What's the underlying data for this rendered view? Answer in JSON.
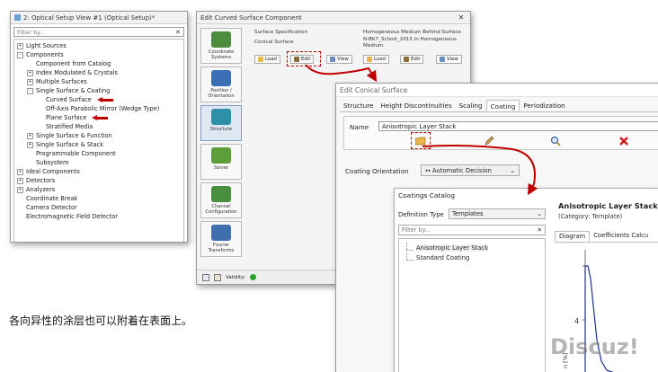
{
  "tree_window": {
    "title": "2: Optical Setup View #1 (Optical Setup)*",
    "filter_placeholder": "Filter by...",
    "items": [
      {
        "label": "Light Sources",
        "expander": "+",
        "level": 0
      },
      {
        "label": "Components",
        "expander": "-",
        "level": 0
      },
      {
        "label": "Component from Catalog",
        "expander": "",
        "level": 1
      },
      {
        "label": "Index Modulated & Crystals",
        "expander": "+",
        "level": 1
      },
      {
        "label": "Multiple Surfaces",
        "expander": "+",
        "level": 1
      },
      {
        "label": "Single Surface & Coating",
        "expander": "-",
        "level": 1
      },
      {
        "label": "Curved Surface",
        "expander": "",
        "level": 2,
        "marked": true
      },
      {
        "label": "Off-Axis Parabolic Mirror (Wedge Type)",
        "expander": "",
        "level": 2
      },
      {
        "label": "Plane Surface",
        "expander": "",
        "level": 2,
        "marked": true
      },
      {
        "label": "Stratified Media",
        "expander": "",
        "level": 2
      },
      {
        "label": "Single Surface & Function",
        "expander": "+",
        "level": 1
      },
      {
        "label": "Single Surface & Stack",
        "expander": "+",
        "level": 1
      },
      {
        "label": "Programmable Component",
        "expander": "",
        "level": 1
      },
      {
        "label": "Subsystem",
        "expander": "",
        "level": 1
      },
      {
        "label": "Ideal Components",
        "expander": "+",
        "level": 0
      },
      {
        "label": "Detectors",
        "expander": "+",
        "level": 0
      },
      {
        "label": "Analyzers",
        "expander": "+",
        "level": 0
      },
      {
        "label": "Coordinate Break",
        "expander": "",
        "level": 0
      },
      {
        "label": "Camera Detector",
        "expander": "",
        "level": 0
      },
      {
        "label": "Electromagnetic Field Detector",
        "expander": "",
        "level": 0
      }
    ]
  },
  "curved_window": {
    "title": "Edit Curved Surface Component",
    "sidebar": [
      {
        "label": "Coordinate Systems",
        "icon": "coordinate-systems-icon",
        "color": "#4d8c3c"
      },
      {
        "label": "Position / Orientation",
        "icon": "position-orientation-icon",
        "color": "#3b6fb6"
      },
      {
        "label": "Structure",
        "icon": "structure-icon",
        "color": "#2d8fa8"
      },
      {
        "label": "Solver",
        "icon": "solver-icon",
        "color": "#5e9e3a"
      },
      {
        "label": "Channel Configuration",
        "icon": "channel-configuration-icon",
        "color": "#4a8f3f"
      },
      {
        "label": "Fourier Transforms",
        "icon": "fourier-transforms-icon",
        "color": "#3f6fae"
      }
    ],
    "surface_spec": {
      "heading": "Surface Specification",
      "value": "Conical Surface"
    },
    "medium_spec": {
      "heading": "Homogeneous Medium Behind Surface",
      "value": "N-BK7_Schott_2015 in Homogeneous Medium"
    },
    "buttons": {
      "load": "Load",
      "edit": "Edit",
      "view": "View"
    },
    "status": {
      "validity": "Validity:"
    }
  },
  "conical_window": {
    "title": "Edit Conical Surface",
    "tabs": [
      "Structure",
      "Height Discontinuities",
      "Scaling",
      "Coating",
      "Periodization"
    ],
    "selected_tab": "Coating",
    "name_label": "Name",
    "name_value": "Anisotropic Layer Stack",
    "orientation_label": "Coating Orientation",
    "orientation_value": "↔ Automatic Decision"
  },
  "catalog": {
    "title": "Coatings Catalog",
    "definition_label": "Definition Type",
    "definition_value": "Templates",
    "filter_placeholder": "Filter by...",
    "items": [
      "Anisotropic Layer Stack",
      "Standard Coating"
    ],
    "preview_title": "Anisotropic Layer Stack",
    "preview_category": "(Category: Template)",
    "preview_tabs": [
      "Diagram",
      "Coefficients Calcu"
    ],
    "plot_ylabel": "n [%]",
    "plot_tick": "4"
  },
  "caption": "各向异性的涂层也可以附着在表面上。",
  "watermark": "Discuz!",
  "colors": {
    "accent_red": "#c00000",
    "selection_blue": "#dfe7f3",
    "validity_green": "#2aa12a"
  }
}
